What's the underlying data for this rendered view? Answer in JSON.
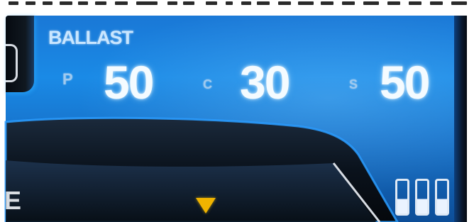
{
  "hud": {
    "ballast_label": "BALLAST",
    "stats": {
      "p_key": "P",
      "p_value": "50",
      "c_key": "C",
      "c_value": "30",
      "s_key": "S",
      "s_value": "50"
    },
    "edge_letter": "E"
  },
  "colors": {
    "panel_blue": "#1a8ae6",
    "value_white": "#f4fbff",
    "arrow_yellow": "#f0b400"
  },
  "icons": [
    "down-arrow-icon",
    "gauge-icon"
  ]
}
